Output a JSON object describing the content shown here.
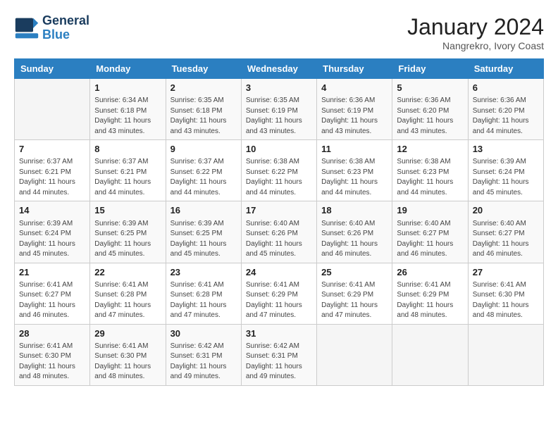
{
  "header": {
    "logo_line1": "General",
    "logo_line2": "Blue",
    "month_year": "January 2024",
    "location": "Nangrekro, Ivory Coast"
  },
  "weekdays": [
    "Sunday",
    "Monday",
    "Tuesday",
    "Wednesday",
    "Thursday",
    "Friday",
    "Saturday"
  ],
  "weeks": [
    [
      {
        "day": "",
        "info": ""
      },
      {
        "day": "1",
        "info": "Sunrise: 6:34 AM\nSunset: 6:18 PM\nDaylight: 11 hours\nand 43 minutes."
      },
      {
        "day": "2",
        "info": "Sunrise: 6:35 AM\nSunset: 6:18 PM\nDaylight: 11 hours\nand 43 minutes."
      },
      {
        "day": "3",
        "info": "Sunrise: 6:35 AM\nSunset: 6:19 PM\nDaylight: 11 hours\nand 43 minutes."
      },
      {
        "day": "4",
        "info": "Sunrise: 6:36 AM\nSunset: 6:19 PM\nDaylight: 11 hours\nand 43 minutes."
      },
      {
        "day": "5",
        "info": "Sunrise: 6:36 AM\nSunset: 6:20 PM\nDaylight: 11 hours\nand 43 minutes."
      },
      {
        "day": "6",
        "info": "Sunrise: 6:36 AM\nSunset: 6:20 PM\nDaylight: 11 hours\nand 44 minutes."
      }
    ],
    [
      {
        "day": "7",
        "info": "Sunrise: 6:37 AM\nSunset: 6:21 PM\nDaylight: 11 hours\nand 44 minutes."
      },
      {
        "day": "8",
        "info": "Sunrise: 6:37 AM\nSunset: 6:21 PM\nDaylight: 11 hours\nand 44 minutes."
      },
      {
        "day": "9",
        "info": "Sunrise: 6:37 AM\nSunset: 6:22 PM\nDaylight: 11 hours\nand 44 minutes."
      },
      {
        "day": "10",
        "info": "Sunrise: 6:38 AM\nSunset: 6:22 PM\nDaylight: 11 hours\nand 44 minutes."
      },
      {
        "day": "11",
        "info": "Sunrise: 6:38 AM\nSunset: 6:23 PM\nDaylight: 11 hours\nand 44 minutes."
      },
      {
        "day": "12",
        "info": "Sunrise: 6:38 AM\nSunset: 6:23 PM\nDaylight: 11 hours\nand 44 minutes."
      },
      {
        "day": "13",
        "info": "Sunrise: 6:39 AM\nSunset: 6:24 PM\nDaylight: 11 hours\nand 45 minutes."
      }
    ],
    [
      {
        "day": "14",
        "info": "Sunrise: 6:39 AM\nSunset: 6:24 PM\nDaylight: 11 hours\nand 45 minutes."
      },
      {
        "day": "15",
        "info": "Sunrise: 6:39 AM\nSunset: 6:25 PM\nDaylight: 11 hours\nand 45 minutes."
      },
      {
        "day": "16",
        "info": "Sunrise: 6:39 AM\nSunset: 6:25 PM\nDaylight: 11 hours\nand 45 minutes."
      },
      {
        "day": "17",
        "info": "Sunrise: 6:40 AM\nSunset: 6:26 PM\nDaylight: 11 hours\nand 45 minutes."
      },
      {
        "day": "18",
        "info": "Sunrise: 6:40 AM\nSunset: 6:26 PM\nDaylight: 11 hours\nand 46 minutes."
      },
      {
        "day": "19",
        "info": "Sunrise: 6:40 AM\nSunset: 6:27 PM\nDaylight: 11 hours\nand 46 minutes."
      },
      {
        "day": "20",
        "info": "Sunrise: 6:40 AM\nSunset: 6:27 PM\nDaylight: 11 hours\nand 46 minutes."
      }
    ],
    [
      {
        "day": "21",
        "info": "Sunrise: 6:41 AM\nSunset: 6:27 PM\nDaylight: 11 hours\nand 46 minutes."
      },
      {
        "day": "22",
        "info": "Sunrise: 6:41 AM\nSunset: 6:28 PM\nDaylight: 11 hours\nand 47 minutes."
      },
      {
        "day": "23",
        "info": "Sunrise: 6:41 AM\nSunset: 6:28 PM\nDaylight: 11 hours\nand 47 minutes."
      },
      {
        "day": "24",
        "info": "Sunrise: 6:41 AM\nSunset: 6:29 PM\nDaylight: 11 hours\nand 47 minutes."
      },
      {
        "day": "25",
        "info": "Sunrise: 6:41 AM\nSunset: 6:29 PM\nDaylight: 11 hours\nand 47 minutes."
      },
      {
        "day": "26",
        "info": "Sunrise: 6:41 AM\nSunset: 6:29 PM\nDaylight: 11 hours\nand 48 minutes."
      },
      {
        "day": "27",
        "info": "Sunrise: 6:41 AM\nSunset: 6:30 PM\nDaylight: 11 hours\nand 48 minutes."
      }
    ],
    [
      {
        "day": "28",
        "info": "Sunrise: 6:41 AM\nSunset: 6:30 PM\nDaylight: 11 hours\nand 48 minutes."
      },
      {
        "day": "29",
        "info": "Sunrise: 6:41 AM\nSunset: 6:30 PM\nDaylight: 11 hours\nand 48 minutes."
      },
      {
        "day": "30",
        "info": "Sunrise: 6:42 AM\nSunset: 6:31 PM\nDaylight: 11 hours\nand 49 minutes."
      },
      {
        "day": "31",
        "info": "Sunrise: 6:42 AM\nSunset: 6:31 PM\nDaylight: 11 hours\nand 49 minutes."
      },
      {
        "day": "",
        "info": ""
      },
      {
        "day": "",
        "info": ""
      },
      {
        "day": "",
        "info": ""
      }
    ]
  ]
}
